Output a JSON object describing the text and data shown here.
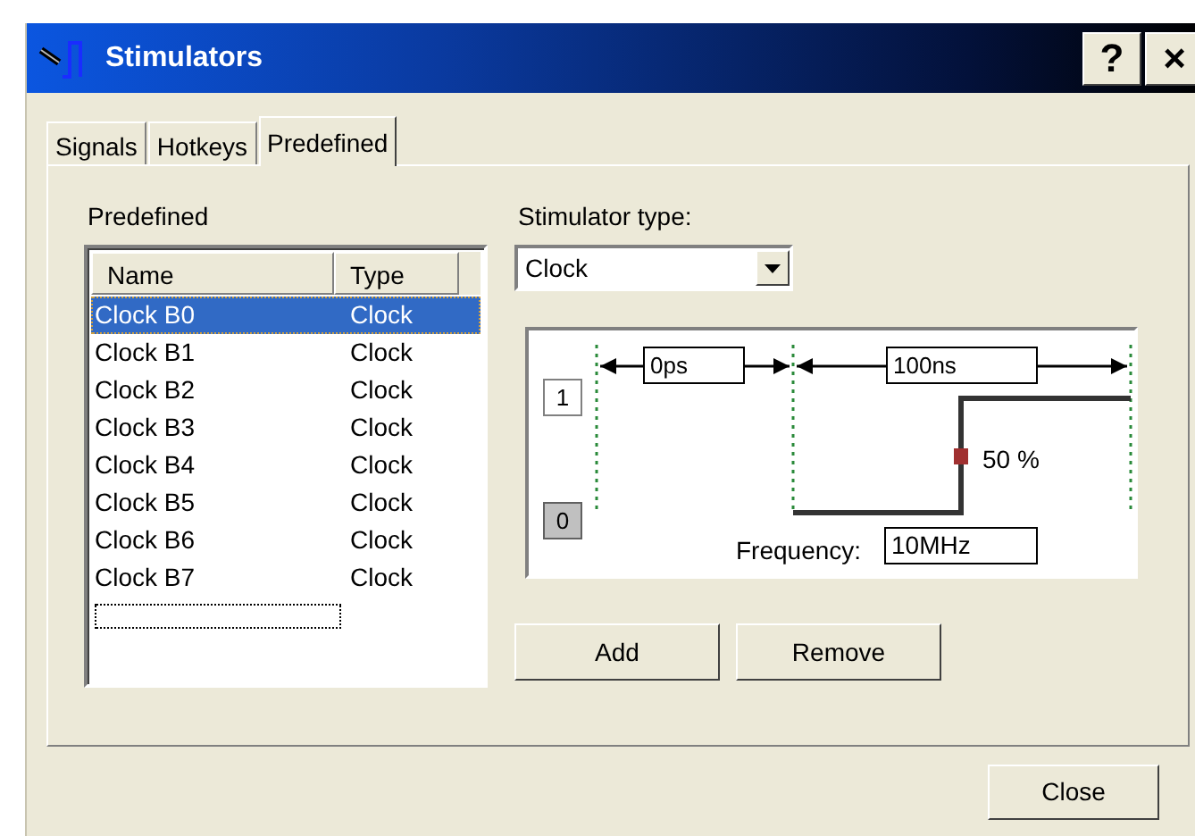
{
  "window": {
    "title": "Stimulators",
    "help_button": "?",
    "close_button": "×"
  },
  "tabs": [
    {
      "label": "Signals",
      "selected": false
    },
    {
      "label": "Hotkeys",
      "selected": false
    },
    {
      "label": "Predefined",
      "selected": true
    }
  ],
  "predefined": {
    "label": "Predefined",
    "columns": [
      "Name",
      "Type"
    ],
    "rows": [
      {
        "name": "Clock B0",
        "type": "Clock",
        "selected": true
      },
      {
        "name": "Clock B1",
        "type": "Clock",
        "selected": false
      },
      {
        "name": "Clock B2",
        "type": "Clock",
        "selected": false
      },
      {
        "name": "Clock B3",
        "type": "Clock",
        "selected": false
      },
      {
        "name": "Clock B4",
        "type": "Clock",
        "selected": false
      },
      {
        "name": "Clock B5",
        "type": "Clock",
        "selected": false
      },
      {
        "name": "Clock B6",
        "type": "Clock",
        "selected": false
      },
      {
        "name": "Clock B7",
        "type": "Clock",
        "selected": false
      }
    ]
  },
  "stimulator_type": {
    "label": "Stimulator type:",
    "value": "Clock"
  },
  "diagram": {
    "delay": "0ps",
    "period": "100ns",
    "levels": [
      {
        "label": "1",
        "selected": false
      },
      {
        "label": "0",
        "selected": true
      }
    ],
    "duty": "50 %",
    "frequency_label": "Frequency:",
    "frequency": "10MHz"
  },
  "actions": [
    "Add",
    "Remove"
  ],
  "footer_button": "Close"
}
